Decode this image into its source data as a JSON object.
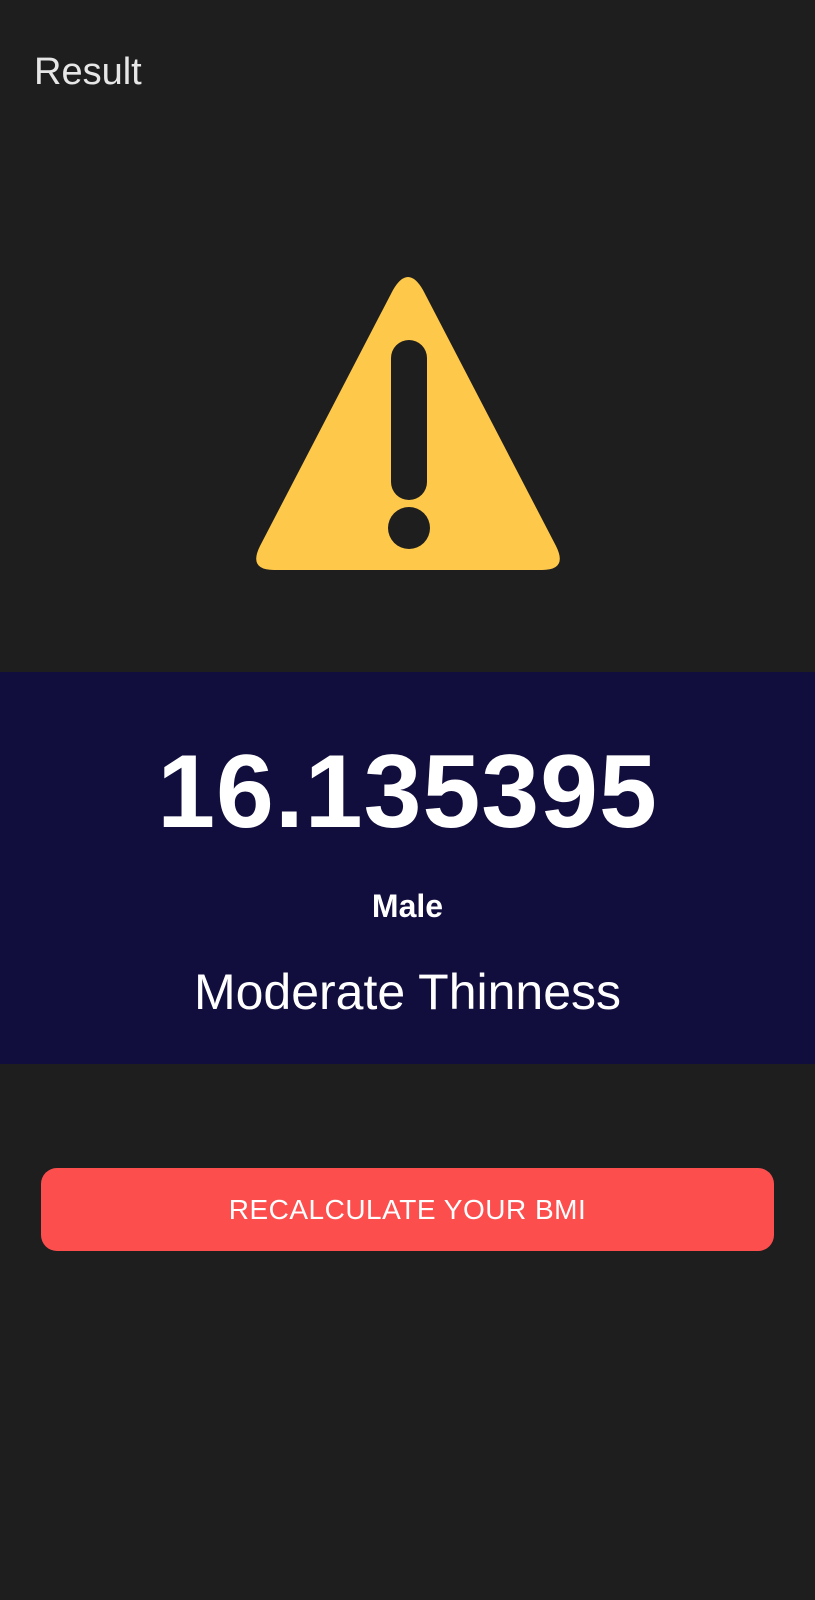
{
  "app_bar": {
    "title": "Result"
  },
  "warning": {
    "icon": "warning-triangle-icon",
    "color": "#fec84b",
    "mark_color": "#1e1e1e"
  },
  "result": {
    "bmi_value": "16.135395",
    "gender": "Male",
    "category": "Moderate Thinness",
    "panel_color": "#110d3d"
  },
  "actions": {
    "recalculate_label": "RECALCULATE YOUR BMI",
    "button_color": "#fd4e4e"
  }
}
